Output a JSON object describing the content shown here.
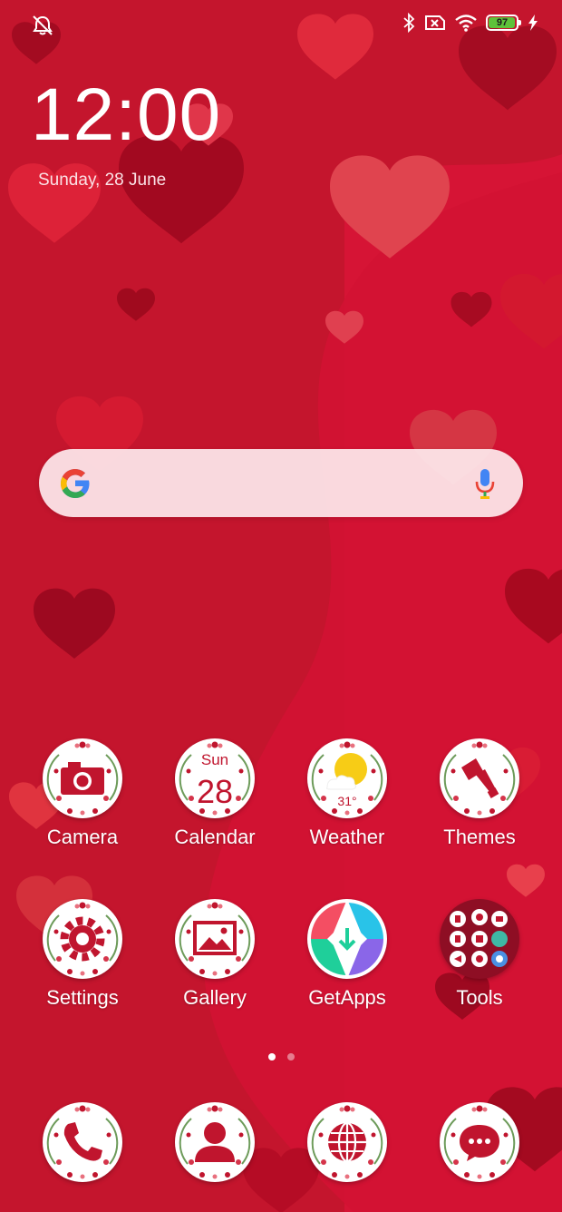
{
  "status_bar": {
    "battery_level": "97",
    "left_icons": [
      "alarm-off-icon"
    ],
    "right_icons": [
      "bluetooth-icon",
      "no-sim-icon",
      "wifi-icon",
      "battery-icon",
      "charging-icon"
    ]
  },
  "lockscreen": {
    "time": "12:00",
    "date": "Sunday, 28 June"
  },
  "search_bar": {
    "logo": "google-logo",
    "mic": "mic-icon"
  },
  "calendar_icon": {
    "day": "Sun",
    "date": "28"
  },
  "weather_icon": {
    "temperature": "31°"
  },
  "apps": [
    {
      "label": "Camera",
      "icon": "camera-icon"
    },
    {
      "label": "Calendar",
      "icon": "calendar-icon"
    },
    {
      "label": "Weather",
      "icon": "weather-icon"
    },
    {
      "label": "Themes",
      "icon": "paint-brush-icon"
    },
    {
      "label": "Settings",
      "icon": "gear-icon"
    },
    {
      "label": "Gallery",
      "icon": "gallery-icon"
    },
    {
      "label": "GetApps",
      "icon": "getapps-icon"
    },
    {
      "label": "Tools",
      "icon": "folder-icon"
    }
  ],
  "dock": [
    {
      "icon": "phone-icon"
    },
    {
      "icon": "contacts-icon"
    },
    {
      "icon": "browser-icon"
    },
    {
      "icon": "messages-icon"
    }
  ],
  "page_indicator": {
    "pages": 2,
    "active": 1
  },
  "colors": {
    "background": "#c8142c",
    "icon_red": "#c0152e",
    "battery_green": "#5ec23a"
  }
}
